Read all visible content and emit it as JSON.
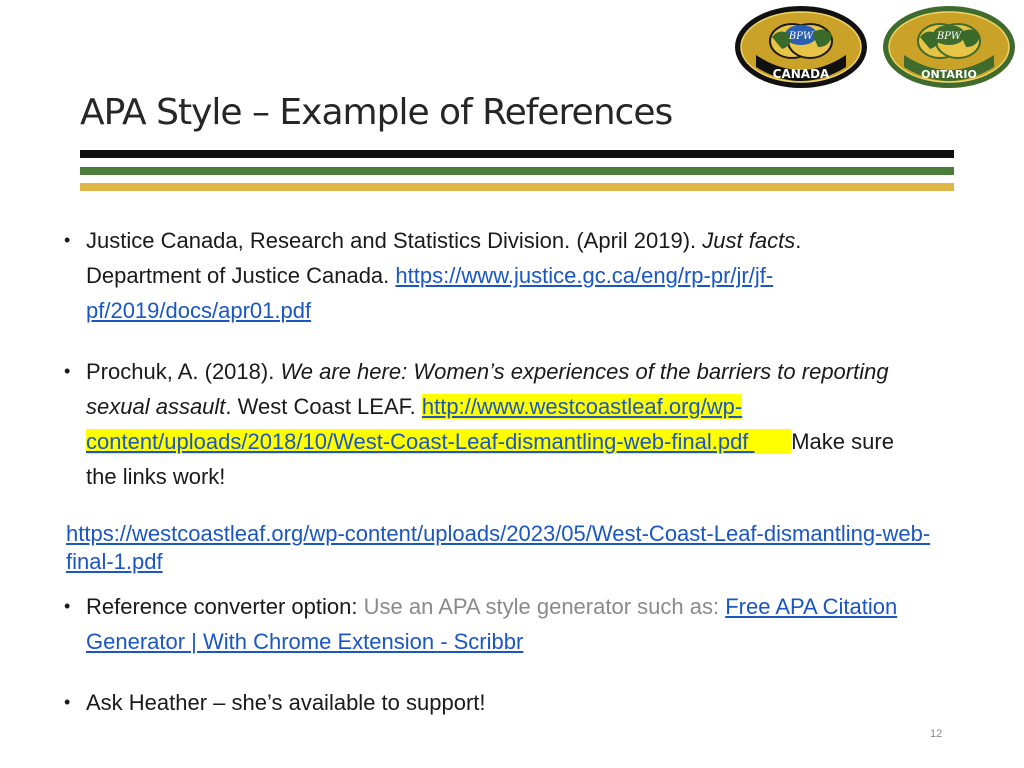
{
  "slide": {
    "title": "APA Style – Example of References",
    "page_number": "12"
  },
  "logos": {
    "canada": {
      "badge": "BPW",
      "name": "CANADA"
    },
    "ontario": {
      "badge": "BPW",
      "name": "ONTARIO"
    }
  },
  "colors": {
    "rule_black": "#111111",
    "rule_green": "#4a7c3a",
    "rule_gold": "#e0b746",
    "link": "#1a56c4",
    "highlight": "#ffff00"
  },
  "references": [
    {
      "prefix": "Justice Canada, Research and Statistics Division. (April 2019). ",
      "title": "Just facts",
      "suffix": ". Department of Justice Canada. ",
      "link": "https://www.justice.gc.ca/eng/rp-pr/jr/jf-pf/2019/docs/apr01.pdf"
    },
    {
      "prefix": "Prochuk, A. (2018). ",
      "title": "We are here: Women’s experiences of the barriers to reporting sexual assault",
      "suffix": ". West Coast LEAF. ",
      "link": "http://www.westcoastleaf.org/wp-content/uploads/2018/10/West-Coast-Leaf-dismantling-web-final.pdf ",
      "note": "Make sure the links work!"
    }
  ],
  "updated_link": "https://westcoastleaf.org/wp-content/uploads/2023/05/West-Coast-Leaf-dismantling-web-final-1.pdf",
  "converter": {
    "label": "Reference converter option: ",
    "hint": "Use an APA style generator such as: ",
    "link": "Free APA Citation Generator | With Chrome Extension - Scribbr"
  },
  "support": {
    "text": "Ask Heather – she’s available to support!"
  },
  "bullet_char": "•"
}
